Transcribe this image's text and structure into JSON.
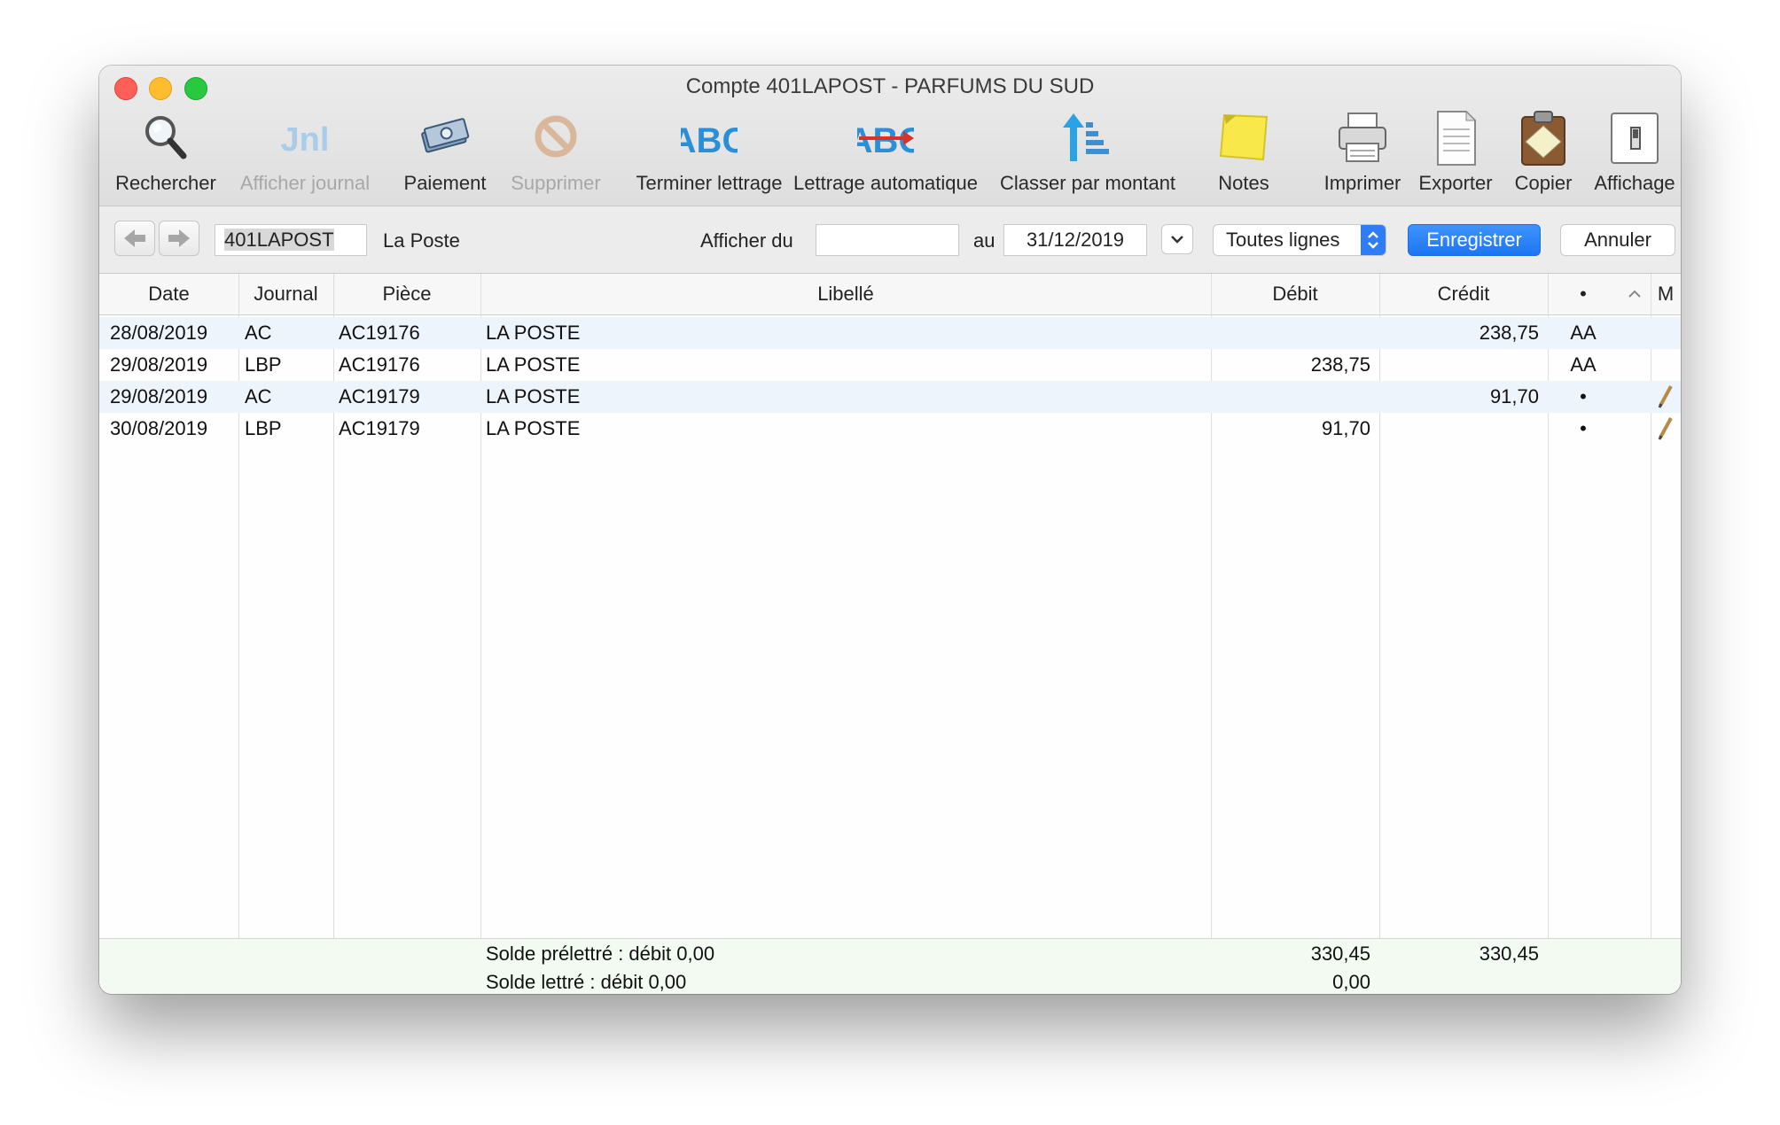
{
  "window": {
    "title": "Compte 401LAPOST - PARFUMS DU SUD"
  },
  "toolbar": {
    "rechercher": "Rechercher",
    "afficher_journal": "Afficher journal",
    "paiement": "Paiement",
    "supprimer": "Supprimer",
    "terminer_lettrage": "Terminer lettrage",
    "lettrage_automatique": "Lettrage automatique",
    "classer_par_montant": "Classer par montant",
    "notes": "Notes",
    "imprimer": "Imprimer",
    "exporter": "Exporter",
    "copier": "Copier",
    "affichage": "Affichage"
  },
  "controls": {
    "account_code": "401LAPOST",
    "account_name": "La Poste",
    "afficher_du_label": "Afficher du",
    "date_from": "",
    "au_label": "au",
    "date_to": "31/12/2019",
    "filter_selected": "Toutes lignes",
    "enregistrer": "Enregistrer",
    "annuler": "Annuler"
  },
  "table": {
    "headers": {
      "date": "Date",
      "journal": "Journal",
      "piece": "Pièce",
      "libelle": "Libellé",
      "debit": "Débit",
      "credit": "Crédit",
      "lettre": "•",
      "m": "M"
    },
    "rows": [
      {
        "date": "28/08/2019",
        "journal": "AC",
        "piece": "AC19176",
        "libelle": "LA POSTE",
        "debit": "",
        "credit": "238,75",
        "lettre": "AA",
        "note": false
      },
      {
        "date": "29/08/2019",
        "journal": "LBP",
        "piece": "AC19176",
        "libelle": "LA POSTE",
        "debit": "238,75",
        "credit": "",
        "lettre": "AA",
        "note": false
      },
      {
        "date": "29/08/2019",
        "journal": "AC",
        "piece": "AC19179",
        "libelle": "LA POSTE",
        "debit": "",
        "credit": "91,70",
        "lettre": "•",
        "note": true
      },
      {
        "date": "30/08/2019",
        "journal": "LBP",
        "piece": "AC19179",
        "libelle": "LA POSTE",
        "debit": "91,70",
        "credit": "",
        "lettre": "•",
        "note": true
      }
    ]
  },
  "footer": {
    "solde_preletre": "Solde prélettré : débit 0,00",
    "preletre_debit": "330,45",
    "preletre_credit": "330,45",
    "solde_lettre": "Solde lettré : débit 0,00",
    "lettre_debit": "0,00"
  }
}
